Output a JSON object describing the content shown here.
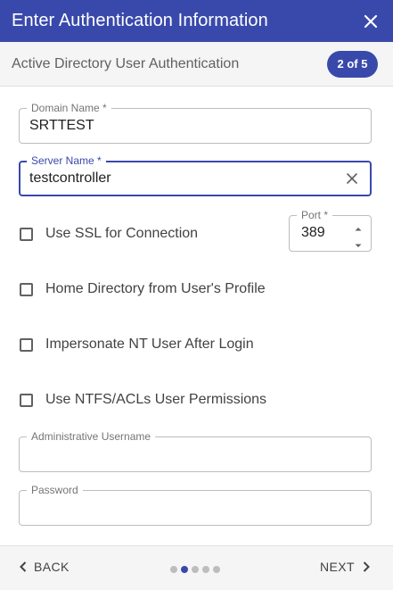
{
  "dialog": {
    "title": "Enter Authentication Information",
    "subtitle": "Active Directory User Authentication",
    "step_badge": "2 of 5"
  },
  "form": {
    "domain_name": {
      "label": "Domain Name *",
      "value": "SRTTEST"
    },
    "server_name": {
      "label": "Server Name *",
      "value": "testcontroller"
    },
    "port": {
      "label": "Port *",
      "value": "389"
    },
    "checkboxes": [
      {
        "label": "Use SSL for Connection",
        "checked": false
      },
      {
        "label": "Home Directory from User's Profile",
        "checked": false
      },
      {
        "label": "Impersonate NT User After Login",
        "checked": false
      },
      {
        "label": "Use NTFS/ACLs User Permissions",
        "checked": false
      }
    ],
    "admin_username": {
      "label": "Administrative Username",
      "value": ""
    },
    "password": {
      "label": "Password",
      "value": ""
    }
  },
  "footer": {
    "back_label": "BACK",
    "next_label": "NEXT",
    "step_dots": {
      "total": 5,
      "active_index": 1
    }
  },
  "colors": {
    "primary": "#3949ab",
    "header_text": "#ffffff",
    "inactive_dot": "#bdbdbd"
  }
}
